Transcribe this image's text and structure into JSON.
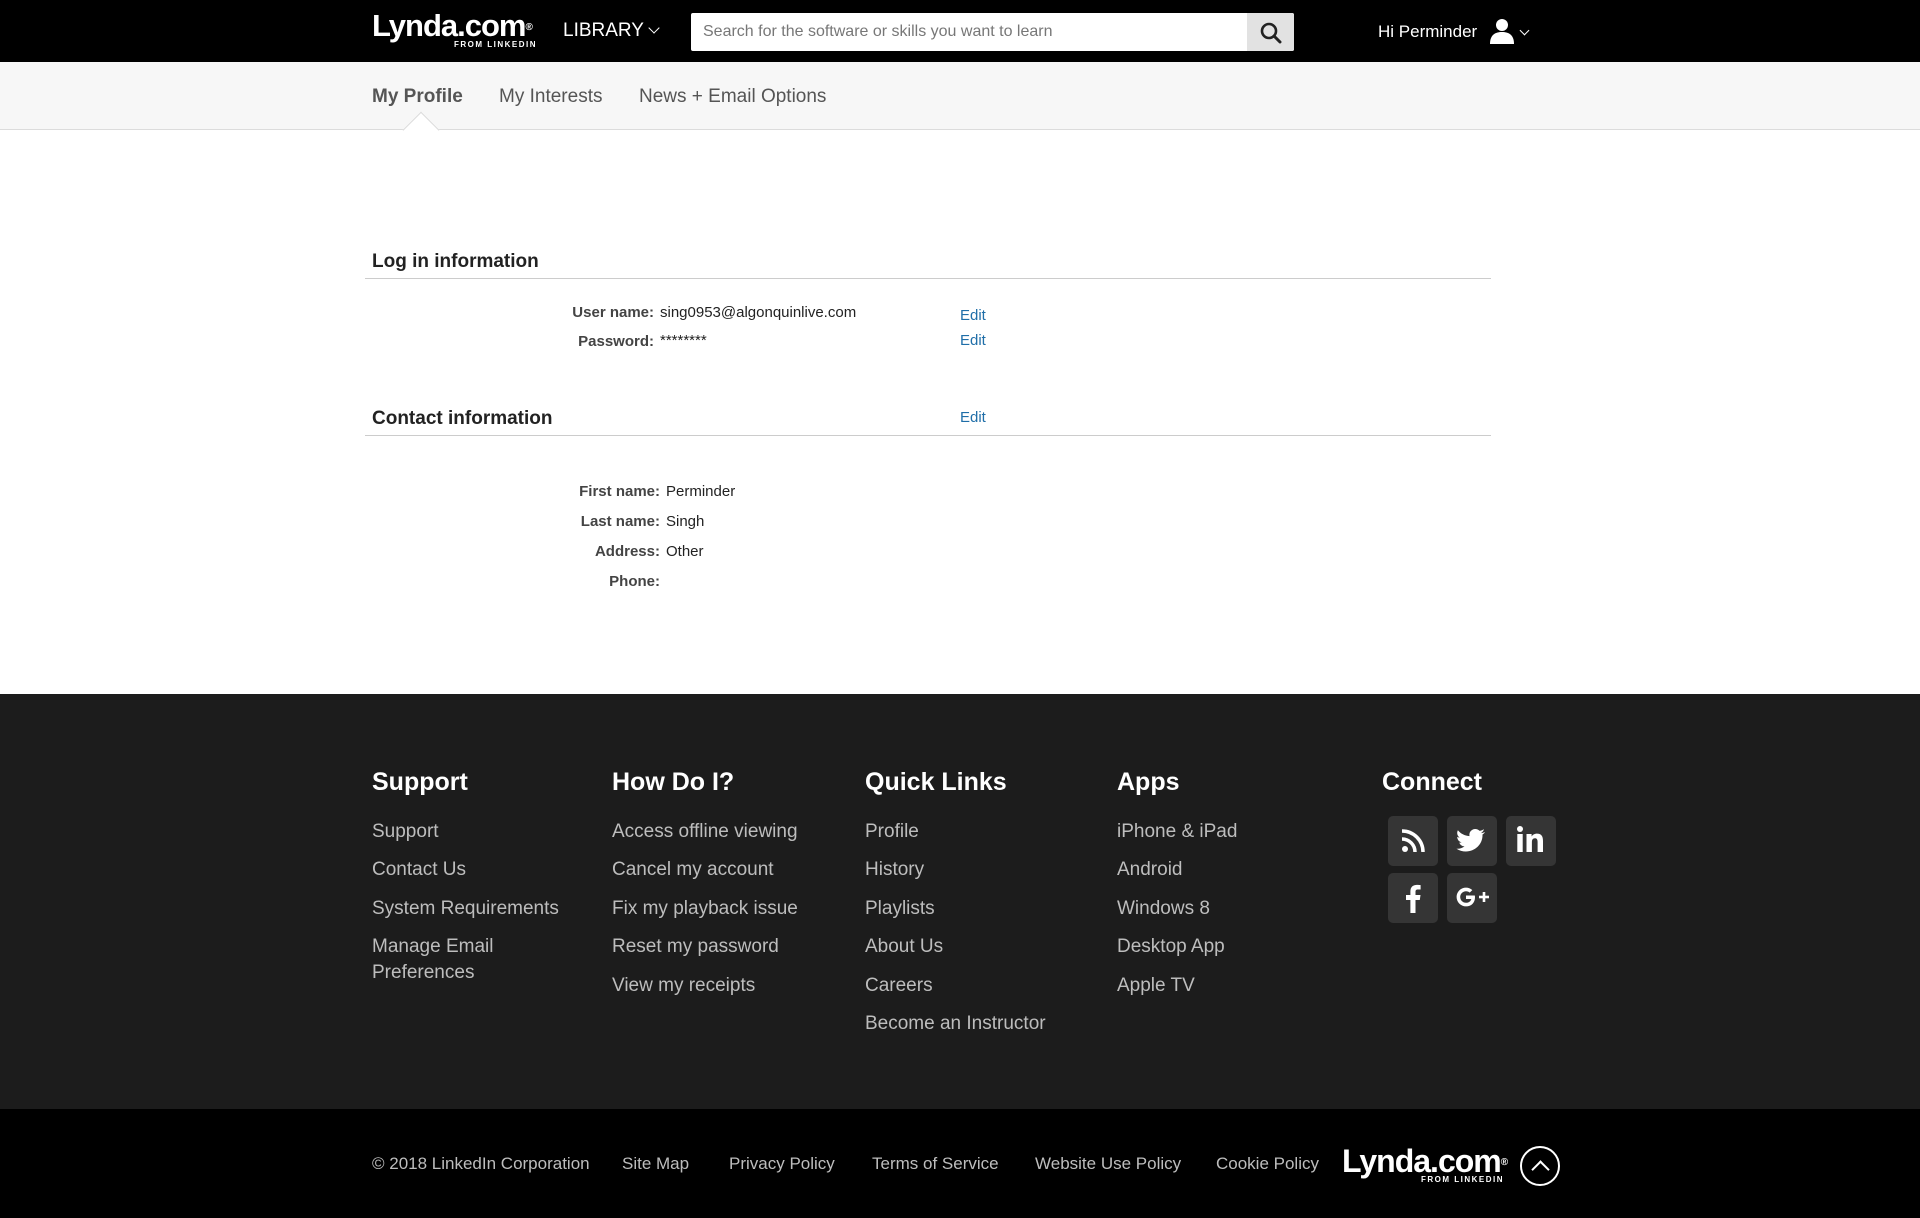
{
  "header": {
    "logo_word": "Lynda.com",
    "logo_reg": "®",
    "logo_sub": "FROM LINKEDIN",
    "library_label": "LIBRARY",
    "search_placeholder": "Search for the software or skills you want to learn",
    "greeting": "Hi Perminder"
  },
  "tabs": [
    {
      "label": "My Profile",
      "active": true
    },
    {
      "label": "My Interests",
      "active": false
    },
    {
      "label": "News + Email Options",
      "active": false
    }
  ],
  "login": {
    "title": "Log in information",
    "username_label": "User name:",
    "username_value": "sing0953@algonquinlive.com",
    "password_label": "Password:",
    "password_value": "********",
    "edit_label": "Edit"
  },
  "contact": {
    "title": "Contact information",
    "edit_label": "Edit",
    "first_name_label": "First name:",
    "first_name_value": "Perminder",
    "last_name_label": "Last name:",
    "last_name_value": "Singh",
    "address_label": "Address:",
    "address_value": "Other",
    "phone_label": "Phone:",
    "phone_value": ""
  },
  "footer": {
    "support": {
      "title": "Support",
      "links": [
        "Support",
        "Contact Us",
        "System Requirements",
        "Manage Email",
        "Preferences"
      ]
    },
    "howdoi": {
      "title": "How Do I?",
      "links": [
        "Access offline viewing",
        "Cancel my account",
        "Fix my playback issue",
        "Reset my password",
        "View my receipts"
      ]
    },
    "quicklinks": {
      "title": "Quick Links",
      "links": [
        "Profile",
        "History",
        "Playlists",
        "About Us",
        "Careers",
        "Become an Instructor"
      ]
    },
    "apps": {
      "title": "Apps",
      "links": [
        "iPhone & iPad",
        "Android",
        "Windows 8",
        "Desktop App",
        "Apple TV"
      ]
    },
    "connect": {
      "title": "Connect",
      "icons": [
        "rss-icon",
        "twitter-icon",
        "linkedin-icon",
        "facebook-icon",
        "google-plus-icon"
      ]
    }
  },
  "bottom": {
    "copyright": "© 2018 LinkedIn Corporation",
    "links": [
      "Site Map",
      "Privacy Policy",
      "Terms of Service",
      "Website Use Policy",
      "Cookie Policy"
    ]
  },
  "colors": {
    "topbar": "#000000",
    "footer": "#1c1c1c",
    "link_blue": "#1f6ea8"
  }
}
